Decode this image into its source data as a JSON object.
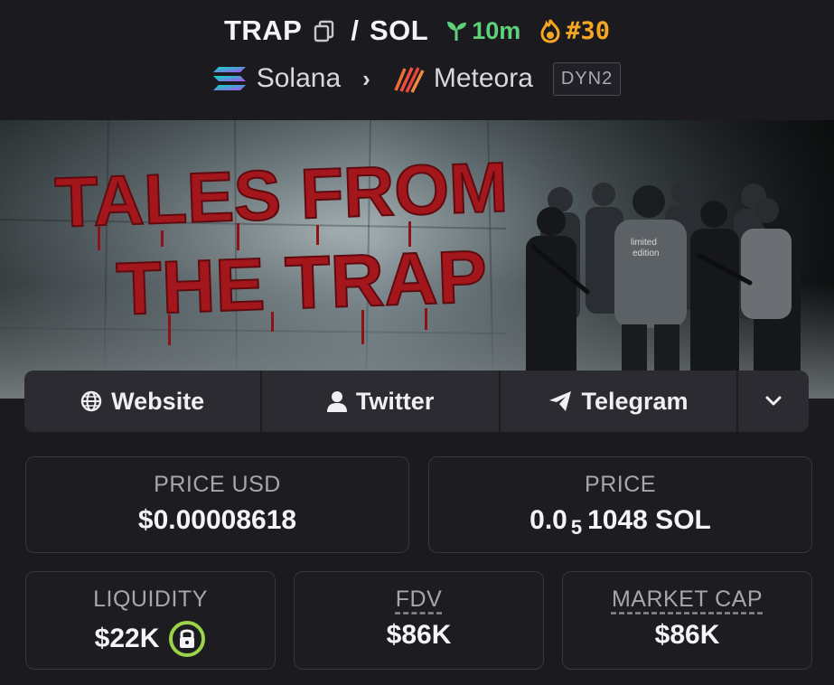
{
  "pair": {
    "base": "TRAP",
    "separator": "/",
    "quote": "SOL",
    "age": "10m",
    "trending_rank": "#30",
    "chain": "Solana",
    "dex": "Meteora",
    "dex_tag": "DYN2"
  },
  "banner": {
    "line1": "TALES FROM",
    "line2": "THE TRAP",
    "shirt_text_1": "limited",
    "shirt_text_2": "edition"
  },
  "links": {
    "website": "Website",
    "twitter": "Twitter",
    "telegram": "Telegram"
  },
  "stats": {
    "price_usd_label": "PRICE USD",
    "price_usd_value": "$0.00008618",
    "price_label": "PRICE",
    "price_lead": "0.0",
    "price_zeros": "5",
    "price_tail": "1048 SOL",
    "liquidity_label": "LIQUIDITY",
    "liquidity_value": "$22K",
    "fdv_label": "FDV",
    "fdv_value": "$86K",
    "mcap_label": "MARKET CAP",
    "mcap_value": "$86K"
  },
  "colors": {
    "background": "#1a1a1f",
    "age_green": "#5ed17a",
    "rank_orange": "#f5a623",
    "lock_green": "#9bd34a",
    "banner_red": "#a3161c"
  }
}
